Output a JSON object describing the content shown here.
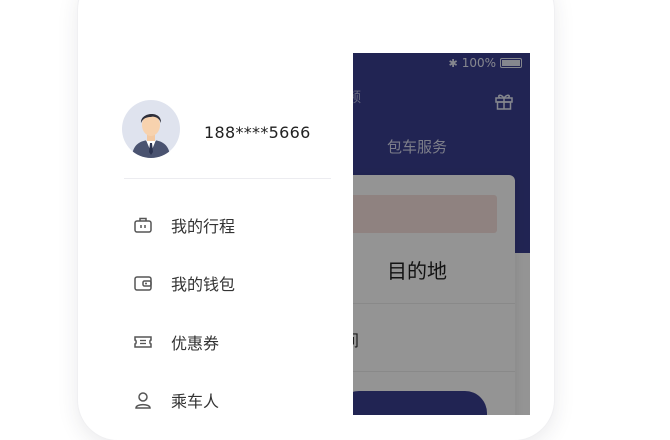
{
  "status_bar": {
    "battery": "100%"
  },
  "header": {
    "title_fragment": "频",
    "charter_tab": "包车服务"
  },
  "booking_card": {
    "destination": "目的地",
    "time_fragment": "对间"
  },
  "drawer": {
    "phone": "188****5666",
    "menu": [
      {
        "label": "我的行程",
        "icon": "briefcase-icon"
      },
      {
        "label": "我的钱包",
        "icon": "wallet-icon"
      },
      {
        "label": "优惠券",
        "icon": "coupon-icon"
      },
      {
        "label": "乘车人",
        "icon": "passenger-icon"
      }
    ]
  },
  "colors": {
    "primary": "#3a3f8f",
    "overlay": "rgba(0,0,0,0.42)",
    "highlight": "#f7e1dc"
  }
}
